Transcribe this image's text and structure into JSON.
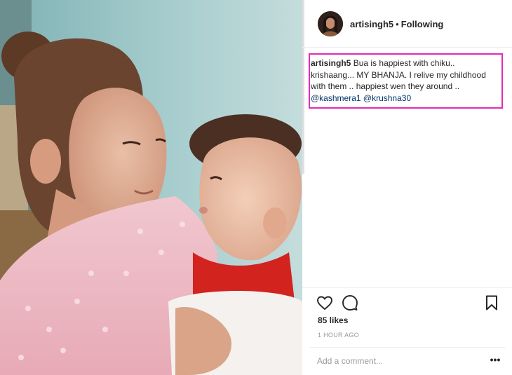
{
  "post": {
    "photo_alt": "",
    "author": {
      "username": "artisingh5",
      "separator": "•",
      "follow_state": "Following"
    },
    "caption": {
      "username": "artisingh5",
      "text": "Bua is happiest with chiku.. krishaang... MY BHANJA. I relive my childhood with them .. happiest wen they around ..",
      "mentions": [
        "@kashmera1",
        "@krushna30"
      ]
    },
    "likes": "85 likes",
    "timestamp": "1 HOUR AGO",
    "comment": {
      "placeholder": "Add a comment..."
    },
    "more_icon_glyph": "•••",
    "icons": {
      "like": "heart-icon",
      "comment": "speech-bubble-icon",
      "save": "bookmark-icon",
      "more": "more-options-icon"
    },
    "highlight_color": "#e629b8",
    "mention_color": "#003569"
  }
}
